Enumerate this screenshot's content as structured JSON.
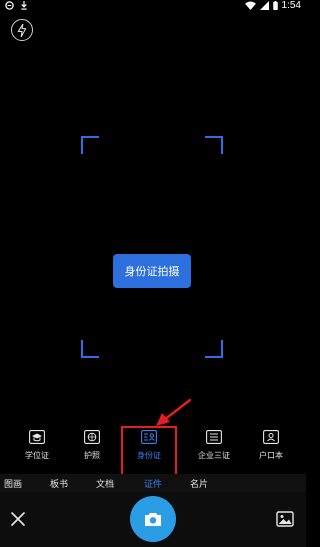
{
  "status_bar": {
    "time": "1:54",
    "icons": [
      "logo-icon",
      "download-icon",
      "wifi-icon",
      "signal-icon",
      "battery-icon"
    ]
  },
  "camera": {
    "flash_icon": "flash-icon",
    "capture_hint": "身份证拍摄",
    "frame_color": "#2f6fe6"
  },
  "doc_types": [
    {
      "label": "学位证",
      "icon": "graduation-cap-icon",
      "active": false
    },
    {
      "label": "护照",
      "icon": "passport-globe-icon",
      "active": false
    },
    {
      "label": "身份证",
      "icon": "id-card-icon",
      "active": true
    },
    {
      "label": "企业三证",
      "icon": "business-license-icon",
      "active": false
    },
    {
      "label": "户口本",
      "icon": "household-register-icon",
      "active": false
    }
  ],
  "modes": [
    {
      "label": "图画",
      "active": false
    },
    {
      "label": "板书",
      "active": false
    },
    {
      "label": "文档",
      "active": false
    },
    {
      "label": "证件",
      "active": true
    },
    {
      "label": "名片",
      "active": false
    }
  ],
  "bottom": {
    "close_icon": "close-icon",
    "shutter_icon": "camera-icon",
    "gallery_icon": "gallery-icon"
  },
  "colors": {
    "accent": "#2d6fdc",
    "active_text": "#3d7ff0",
    "shutter": "#2a9de5",
    "highlight": "#e51f1f"
  }
}
